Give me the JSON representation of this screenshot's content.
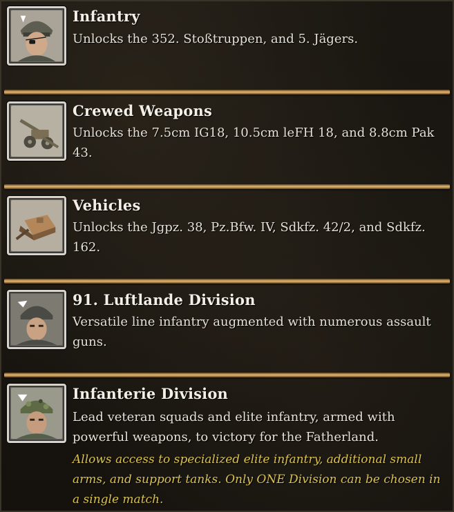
{
  "items": [
    {
      "icon": "soldier-eyepatch-icon",
      "title": "Infantry",
      "desc": "Unlocks the 352. Stoßtruppen, and 5. Jägers."
    },
    {
      "icon": "artillery-gun-icon",
      "title": "Crewed Weapons",
      "desc": "Unlocks the 7.5cm IG18, 10.5cm leFH 18, and 8.8cm Pak 43."
    },
    {
      "icon": "tank-destroyer-icon",
      "title": "Vehicles",
      "desc": "Unlocks the Jgpz. 38, Pz.Bfw. IV, Sdkfz. 42/2, and Sdkfz. 162."
    },
    {
      "icon": "paratrooper-helmet-icon",
      "title": "91. Luftlande Division",
      "desc": "Versatile line infantry augmented with numerous assault guns."
    },
    {
      "icon": "camo-helmet-soldier-icon",
      "title": "Infanterie Division",
      "desc": "Lead veteran squads and elite infantry, armed with powerful weapons, to victory for the Fatherland.",
      "note": "Allows access to specialized elite infantry, additional small arms, and support tanks. Only ONE Division can be chosen in a single match."
    }
  ],
  "colors": {
    "title": "#f3efe6",
    "text": "#e6e1d6",
    "note": "#d9c24f",
    "divider": "#c49a5a"
  }
}
